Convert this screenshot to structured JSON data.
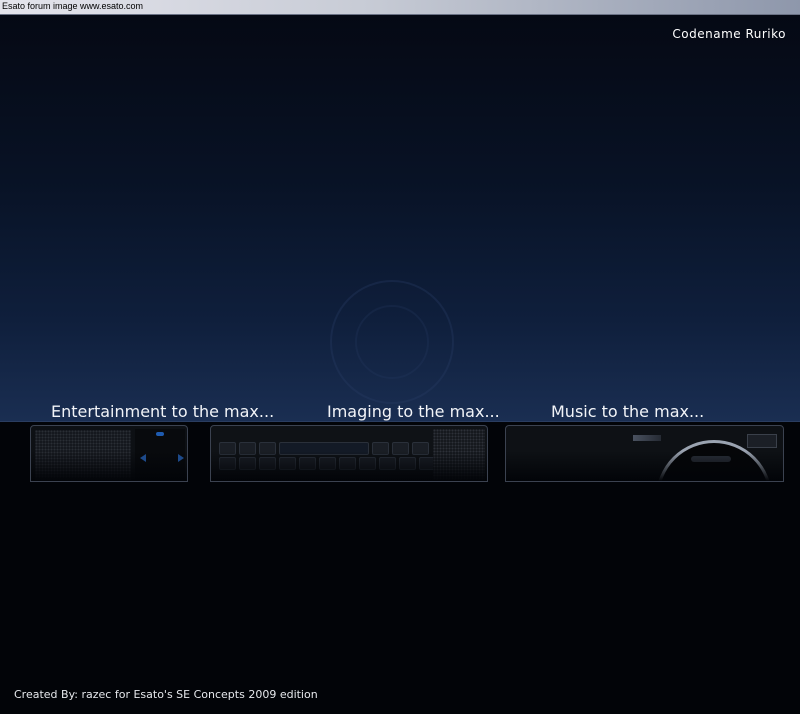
{
  "window": {
    "title": "Esato forum image www.esato.com"
  },
  "header": {
    "codename": "Codename Ruriko"
  },
  "taglines": [
    "Entertainment to the max...",
    "Imaging to the max...",
    "Music to the max..."
  ],
  "footer": {
    "credit": "Created By: razec for Esato's SE Concepts 2009 edition"
  },
  "colors": {
    "sky_top": "#050914",
    "sky_bottom": "#1a2e52",
    "accent": "#1e5bb0",
    "ground": "#020408"
  },
  "icons": [
    "play-left-icon",
    "play-right-icon",
    "keyboard-keys",
    "camera-lens-icon"
  ]
}
